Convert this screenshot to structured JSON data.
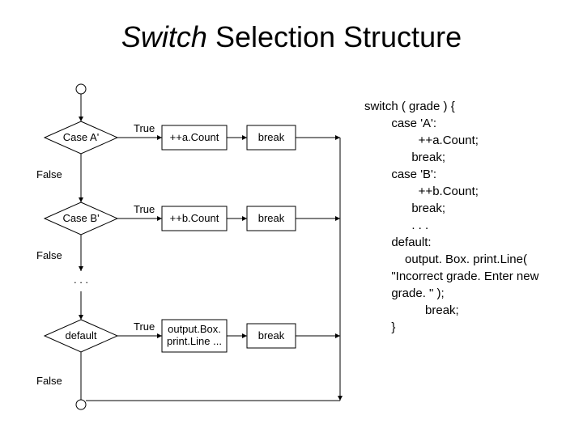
{
  "title_italic": "Switch",
  "title_rest": " Selection Structure",
  "nodes": {
    "caseA": "Case A'",
    "caseB": "Case B'",
    "default": "default",
    "countA": "++a.Count",
    "countB": "++b.Count",
    "outputBox": "output.Box.\nprint.Line ...",
    "break": "break"
  },
  "labels": {
    "true": "True",
    "false": "False",
    "ellipsis": ". . ."
  },
  "code": {
    "l0": "switch ( grade ) {",
    "l1": "        case 'A':",
    "l2": "                ++a.Count;",
    "l3": "              break;",
    "l4": "        case 'B':",
    "l5": "                ++b.Count;",
    "l6": "              break;",
    "l7": "              . . .",
    "l8": "        default:",
    "l9": "            output. Box. print.Line(",
    "l10": "        \"Incorrect grade. Enter new",
    "l11": "        grade. \" );",
    "l12": "                  break;",
    "l13": "        }"
  }
}
